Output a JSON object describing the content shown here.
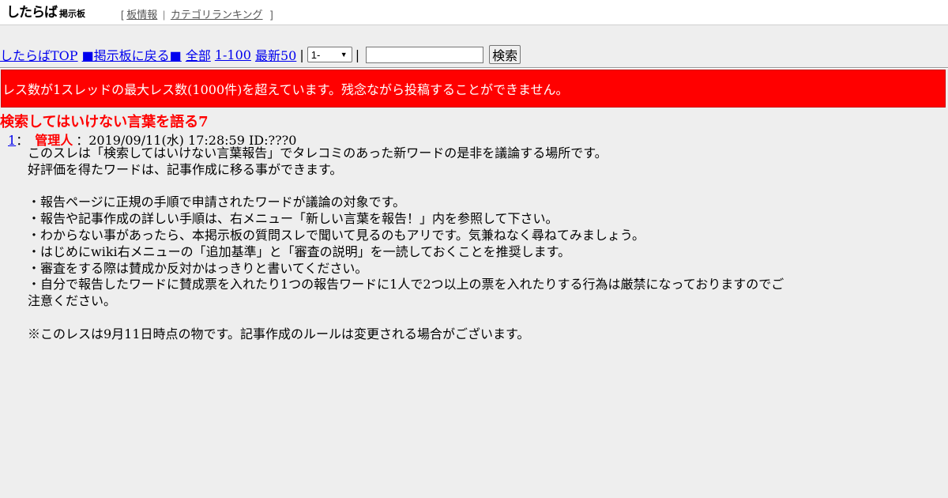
{
  "header": {
    "logo_main": "したらば",
    "logo_sub": "掲示板",
    "bracket_open": "[",
    "bracket_close": "]",
    "links": [
      "板情報",
      "カテゴリランキング"
    ],
    "separator": "|"
  },
  "nav": {
    "links": [
      "したらばTOP",
      "■掲示板に戻る■",
      "全部",
      "1-100",
      "最新50"
    ],
    "separator": "|",
    "select_value": "1-",
    "search_value": "",
    "search_button": "検索"
  },
  "warning": {
    "text": "レス数が1スレッドの最大レス数(1000件)を超えています。残念ながら投稿することができません。",
    "color": "#ff0000"
  },
  "thread": {
    "title": "検索してはいけない言葉を語る7",
    "posts": [
      {
        "number": "1",
        "colon": "：",
        "name": "管理人",
        "meta": "：2019/09/11(水) 17:28:59 ID:???0",
        "lines": [
          "このスレは「検索してはいけない言葉報告」でタレコミのあった新ワードの是非を議論する場所です。",
          "好評価を得たワードは、記事作成に移る事ができます。",
          "",
          "・報告ページに正規の手順で申請されたワードが議論の対象です。",
          "・報告や記事作成の詳しい手順は、右メニュー「新しい言葉を報告！」内を参照して下さい。",
          "・わからない事があったら、本掲示板の質問スレで聞いて見るのもアリです。気兼ねなく尋ねてみましょう。",
          "・はじめにwiki右メニューの「追加基準」と「審査の説明」を一読しておくことを推奨します。",
          "・審査をする際は賛成か反対かはっきりと書いてください。",
          "・自分で報告したワードに賛成票を入れたり1つの報告ワードに1人で2つ以上の票を入れたりする行為は厳禁になっておりますのでご",
          "注意ください。",
          "",
          "※このレスは9月11日時点の物です。記事作成のルールは変更される場合がございます。"
        ]
      }
    ]
  }
}
